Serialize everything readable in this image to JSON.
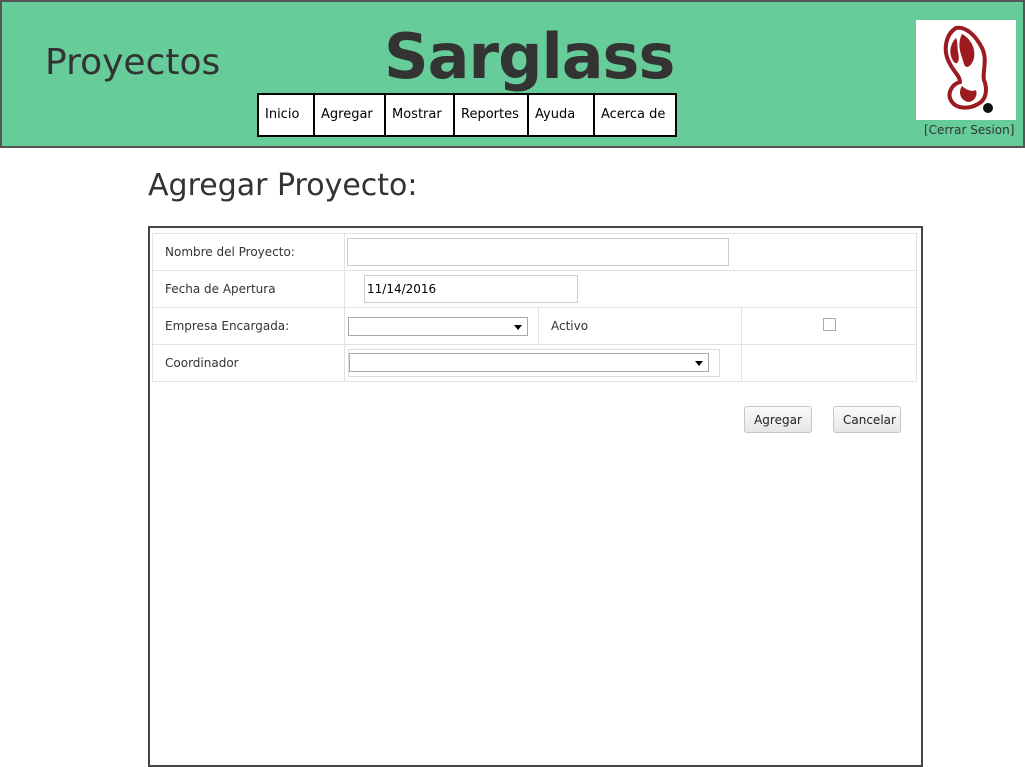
{
  "header": {
    "section_title": "Proyectos",
    "brand": "Sarglass",
    "logout_link": "[Cerrar Sesion]",
    "logo_icon": "butterfly-logo-icon",
    "colors": {
      "background": "#66cc99",
      "border": "#555555",
      "logo": "#9b1b20"
    }
  },
  "nav": {
    "items": [
      {
        "label": "Inicio"
      },
      {
        "label": "Agregar"
      },
      {
        "label": "Mostrar"
      },
      {
        "label": "Reportes"
      },
      {
        "label": "Ayuda"
      },
      {
        "label": "Acerca de"
      }
    ]
  },
  "page": {
    "title": "Agregar Proyecto:"
  },
  "form": {
    "nombre_label": "Nombre del Proyecto:",
    "nombre_value": "",
    "fecha_label": "Fecha de Apertura",
    "fecha_value": "11/14/2016",
    "empresa_label": "Empresa Encargada:",
    "empresa_value": "",
    "activo_label": "Activo",
    "activo_checked": false,
    "coordinador_label": "Coordinador",
    "coordinador_value": "",
    "dropdown_icon": "dropdown-arrow-icon"
  },
  "buttons": {
    "agregar": "Agregar",
    "cancelar": "Cancelar"
  }
}
